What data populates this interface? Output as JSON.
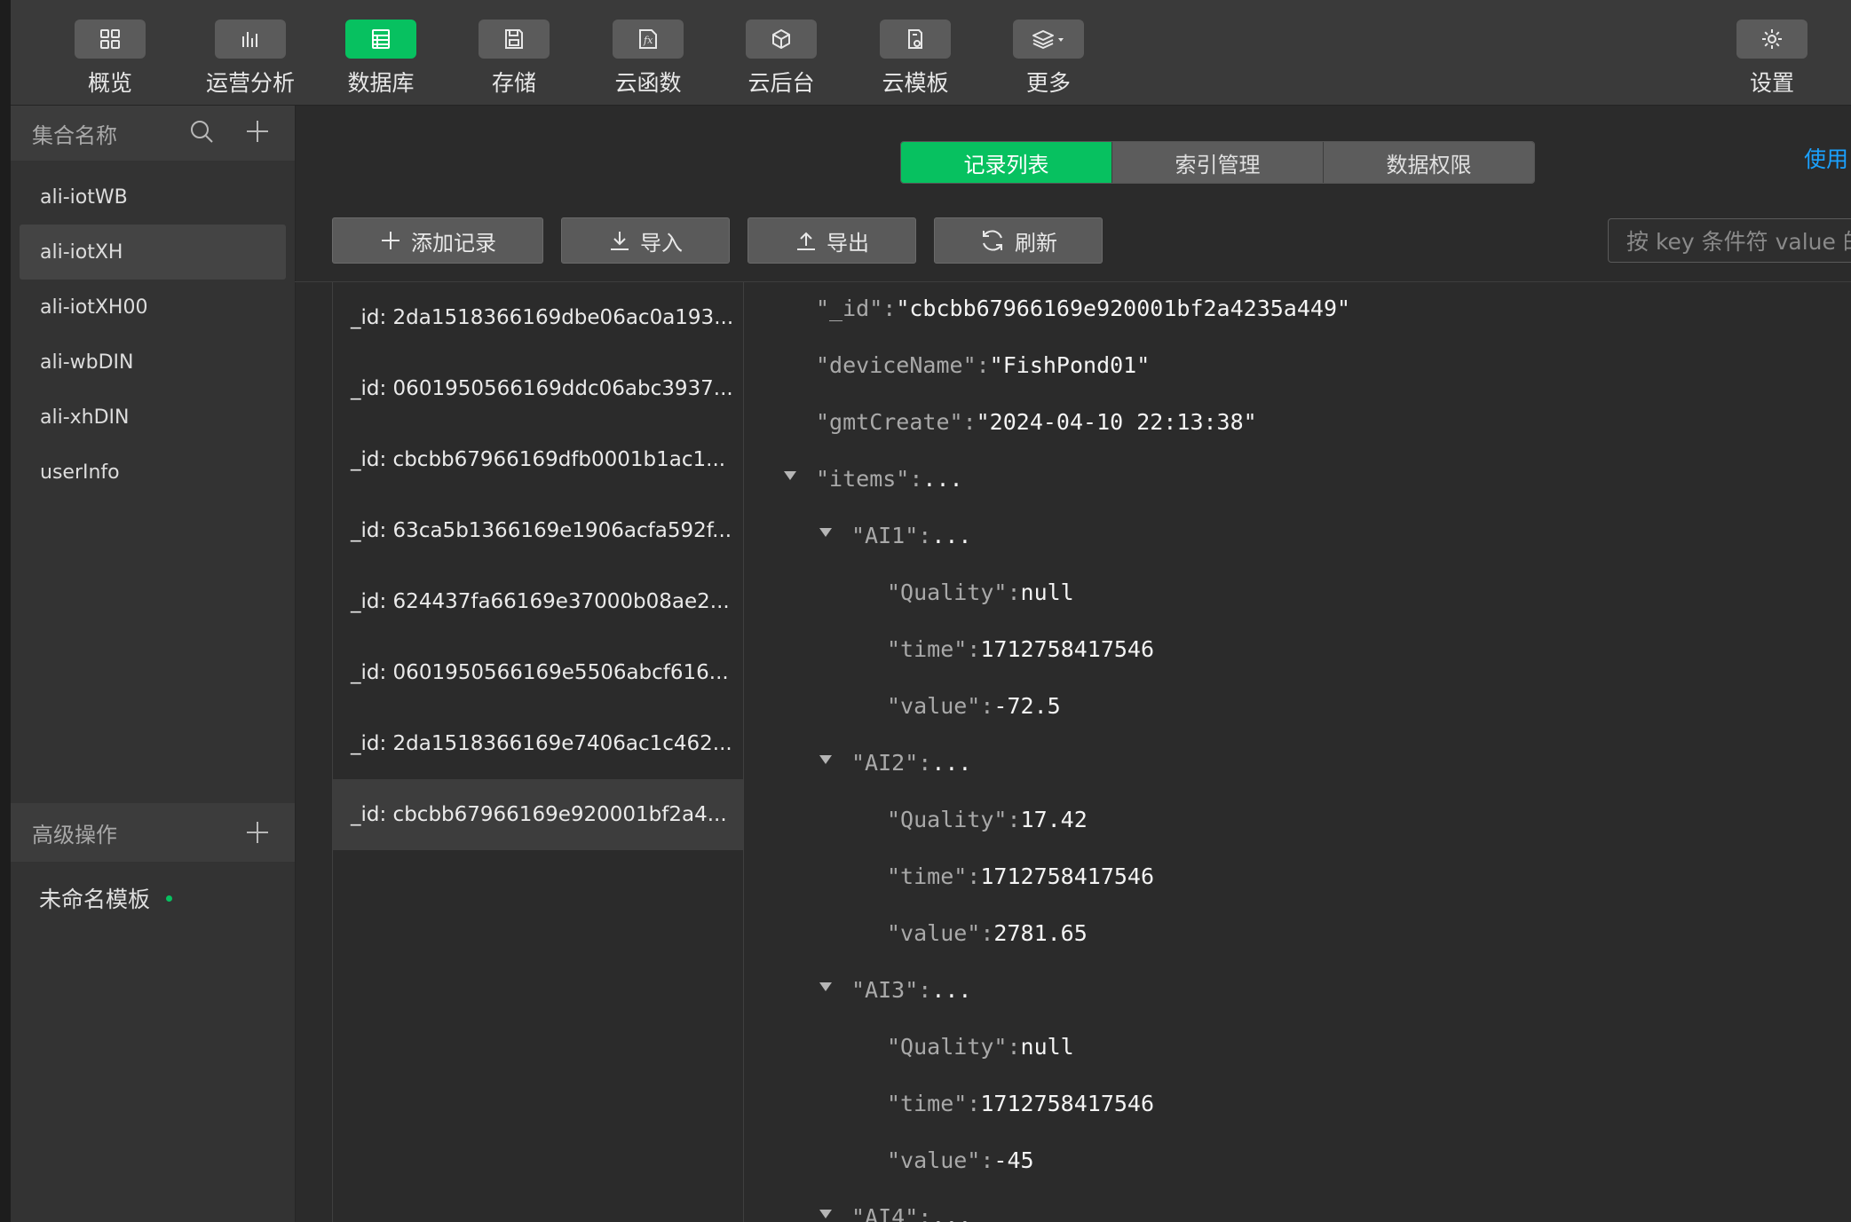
{
  "toolbar": {
    "items": [
      {
        "label": "概览",
        "icon": "grid-icon"
      },
      {
        "label": "运营分析",
        "icon": "bar-chart-icon"
      },
      {
        "label": "数据库",
        "icon": "database-icon"
      },
      {
        "label": "存储",
        "icon": "save-icon"
      },
      {
        "label": "云函数",
        "icon": "function-icon"
      },
      {
        "label": "云后台",
        "icon": "cube-icon"
      },
      {
        "label": "云模板",
        "icon": "template-icon"
      },
      {
        "label": "更多",
        "icon": "layers-icon"
      }
    ],
    "settings_label": "设置",
    "active": "数据库",
    "accent_color": "#07c160"
  },
  "sidebar": {
    "collections_title": "集合名称",
    "collections": [
      "ali-iotWB",
      "ali-iotXH",
      "ali-iotXH00",
      "ali-wbDIN",
      "ali-xhDIN",
      "userInfo"
    ],
    "selected_collection": "ali-iotXH",
    "advanced_title": "高级操作",
    "templates": [
      {
        "label": "未命名模板",
        "status_color": "#07c160"
      }
    ]
  },
  "tabs": [
    "记录列表",
    "索引管理",
    "数据权限"
  ],
  "active_tab": "记录列表",
  "use_link": "使用",
  "actions": {
    "add": "添加记录",
    "import": "导入",
    "export": "导出",
    "refresh": "刷新"
  },
  "search": {
    "placeholder": "按 key 条件符 value 的"
  },
  "records": [
    "_id: 2da1518366169dbe06ac0a193...",
    "_id: 0601950566169ddc06abc3937...",
    "_id: cbcbb67966169dfb0001b1ac1...",
    "_id: 63ca5b1366169e1906acfa592f...",
    "_id: 624437fa66169e37000b08ae2...",
    "_id: 0601950566169e5506abcf616...",
    "_id: 2da1518366169e7406ac1c462...",
    "_id: cbcbb67966169e920001bf2a4..."
  ],
  "selected_record_index": 7,
  "json": {
    "lines": [
      {
        "key": "\"_id\":",
        "value": "\"cbcbb67966169e920001bf2a4235a449\""
      },
      {
        "key": "\"deviceName\":",
        "value": "\"FishPond01\""
      },
      {
        "key": "\"gmtCreate\":",
        "value": "\"2024-04-10 22:13:38\""
      },
      {
        "key": "\"items\":",
        "value": "..."
      },
      {
        "key": "\"AI1\":",
        "value": "..."
      },
      {
        "key": "\"Quality\":",
        "value": "null"
      },
      {
        "key": "\"time\":",
        "value": "1712758417546"
      },
      {
        "key": "\"value\":",
        "value": "-72.5"
      },
      {
        "key": "\"AI2\":",
        "value": "..."
      },
      {
        "key": "\"Quality\":",
        "value": "17.42"
      },
      {
        "key": "\"time\":",
        "value": "1712758417546"
      },
      {
        "key": "\"value\":",
        "value": "2781.65"
      },
      {
        "key": "\"AI3\":",
        "value": "..."
      },
      {
        "key": "\"Quality\":",
        "value": "null"
      },
      {
        "key": "\"time\":",
        "value": "1712758417546"
      },
      {
        "key": "\"value\":",
        "value": "-45"
      },
      {
        "key": "\"AI4\":",
        "value": "..."
      }
    ]
  }
}
